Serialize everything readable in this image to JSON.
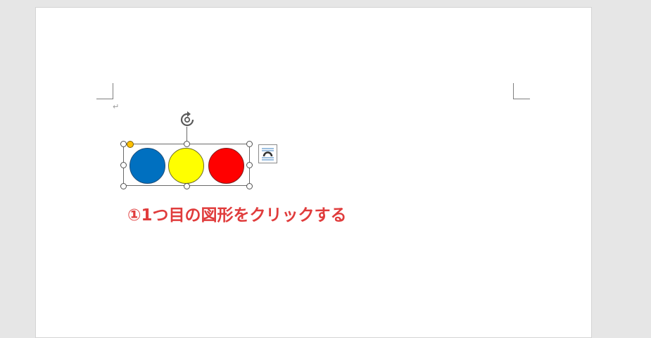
{
  "document": {
    "paragraph_mark": "↵",
    "annotation_text": "①1つ目の図形をクリックする"
  },
  "colors": {
    "circle_blue": "#0070c0",
    "circle_yellow": "#ffff00",
    "circle_red": "#ff0000",
    "adjust_handle": "#ffc000",
    "annotation": "#e03c3c"
  },
  "icons": {
    "rotate": "rotate-handle-icon",
    "layout_options": "layout-options-icon"
  }
}
